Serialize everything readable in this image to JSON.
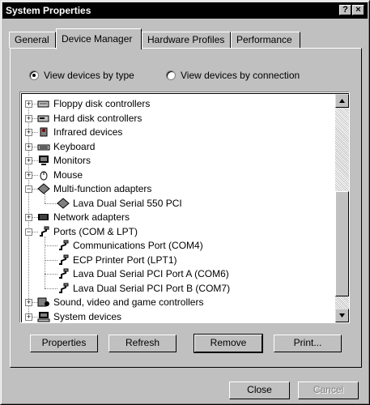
{
  "window": {
    "title": "System Properties",
    "help_label": "?",
    "close_label": "×"
  },
  "tabs": [
    "General",
    "Device Manager",
    "Hardware Profiles",
    "Performance"
  ],
  "radios": {
    "by_type": "View devices by type",
    "by_connection": "View devices by connection",
    "selected": "by_type"
  },
  "tree": [
    {
      "label": "Floppy disk controllers",
      "icon": "floppy-controller-icon",
      "level": 0,
      "expanded": false
    },
    {
      "label": "Hard disk controllers",
      "icon": "hard-disk-controller-icon",
      "level": 0,
      "expanded": false
    },
    {
      "label": "Infrared devices",
      "icon": "infrared-icon",
      "level": 0,
      "expanded": false
    },
    {
      "label": "Keyboard",
      "icon": "keyboard-icon",
      "level": 0,
      "expanded": false
    },
    {
      "label": "Monitors",
      "icon": "monitor-icon",
      "level": 0,
      "expanded": false
    },
    {
      "label": "Mouse",
      "icon": "mouse-icon",
      "level": 0,
      "expanded": false
    },
    {
      "label": "Multi-function adapters",
      "icon": "adapter-icon",
      "level": 0,
      "expanded": true
    },
    {
      "label": "Lava Dual Serial 550 PCI",
      "icon": "adapter-icon",
      "level": 1
    },
    {
      "label": "Network adapters",
      "icon": "network-adapter-icon",
      "level": 0,
      "expanded": false
    },
    {
      "label": "Ports (COM & LPT)",
      "icon": "port-icon",
      "level": 0,
      "expanded": true
    },
    {
      "label": "Communications Port (COM4)",
      "icon": "port-icon",
      "level": 1
    },
    {
      "label": "ECP Printer Port (LPT1)",
      "icon": "port-icon",
      "level": 1
    },
    {
      "label": "Lava Dual Serial PCI Port A (COM6)",
      "icon": "port-icon",
      "level": 1
    },
    {
      "label": "Lava Dual Serial PCI Port B (COM7)",
      "icon": "port-icon",
      "level": 1
    },
    {
      "label": "Sound, video and game controllers",
      "icon": "sound-icon",
      "level": 0,
      "expanded": false
    },
    {
      "label": "System devices",
      "icon": "system-devices-icon",
      "level": 0,
      "expanded": false
    }
  ],
  "buttons": {
    "properties": "Properties",
    "refresh": "Refresh",
    "remove": "Remove",
    "print": "Print..."
  },
  "dialog_buttons": {
    "close": "Close",
    "cancel": "Cancel"
  },
  "colors": {
    "face": "#c0c0c0",
    "titlebar": "#000000",
    "window": "#ffffff"
  }
}
